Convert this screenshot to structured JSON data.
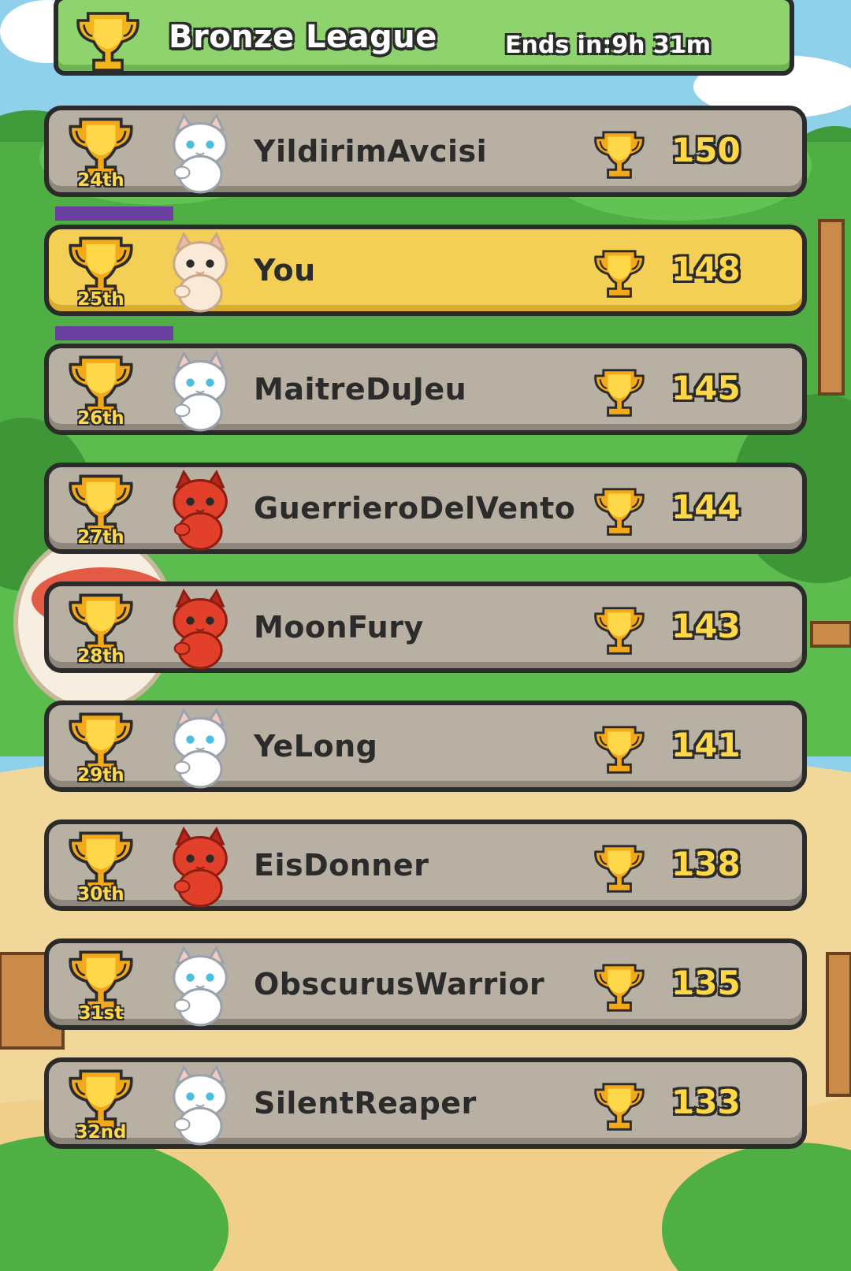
{
  "header": {
    "title": "Bronze League",
    "timer": "Ends in:9h 31m",
    "trophy_icon": "trophy-icon"
  },
  "colors": {
    "row_default": "#b8b0a3",
    "row_current_player": "#f4cf55",
    "score_text": "#ffd84a",
    "outline": "#2b2b2b",
    "banner": "#8fd36f"
  },
  "leaderboard": [
    {
      "rank": "24th",
      "name": "YildirimAvcisi",
      "score": "150",
      "avatar": "white-cat-blue-eyes",
      "is_me": false
    },
    {
      "rank": "25th",
      "name": "You",
      "score": "148",
      "avatar": "cream-cat-arms-crossed",
      "is_me": true
    },
    {
      "rank": "26th",
      "name": "MaitreDuJeu",
      "score": "145",
      "avatar": "white-cat-waving",
      "is_me": false
    },
    {
      "rank": "27th",
      "name": "GuerrieroDelVento",
      "score": "144",
      "avatar": "red-cat",
      "is_me": false
    },
    {
      "rank": "28th",
      "name": "MoonFury",
      "score": "143",
      "avatar": "red-cat",
      "is_me": false
    },
    {
      "rank": "29th",
      "name": "YeLong",
      "score": "141",
      "avatar": "white-cat-blue-eyes",
      "is_me": false
    },
    {
      "rank": "30th",
      "name": "EisDonner",
      "score": "138",
      "avatar": "red-cat",
      "is_me": false
    },
    {
      "rank": "31st",
      "name": "ObscurusWarrior",
      "score": "135",
      "avatar": "white-cat-fluffy",
      "is_me": false
    },
    {
      "rank": "32nd",
      "name": "SilentReaper",
      "score": "133",
      "avatar": "white-cat-blue-eyes",
      "is_me": false
    }
  ]
}
